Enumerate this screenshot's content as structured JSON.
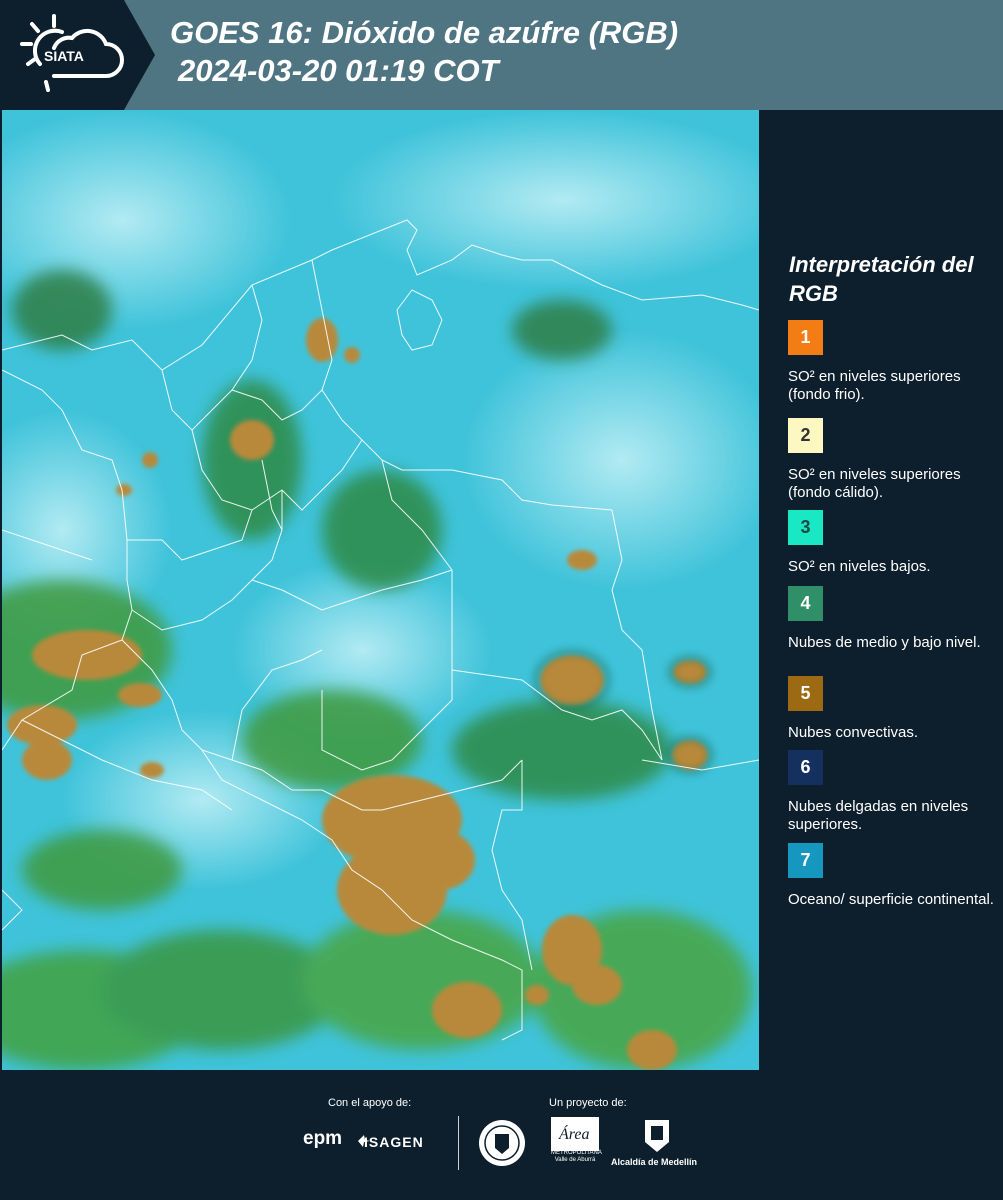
{
  "header": {
    "logo_text": "SIATA",
    "title_line1": "GOES 16: Dióxido de azúfre (RGB)",
    "title_line2": "2024-03-20 01:19 COT",
    "bg_color": "#4f7583"
  },
  "legend": {
    "title": "Interpretación del RGB",
    "items": [
      {
        "number": "1",
        "color": "#f47c14",
        "label": "SO² en niveles superiores (fondo frio)."
      },
      {
        "number": "2",
        "color": "#fdf7c2",
        "label": "SO² en niveles superiores (fondo cálido)."
      },
      {
        "number": "3",
        "color": "#1ae8c5",
        "label": "SO² en niveles bajos."
      },
      {
        "number": "4",
        "color": "#2e8f68",
        "label": "Nubes de medio y bajo nivel."
      },
      {
        "number": "5",
        "color": "#9c6a12",
        "label": "Nubes convectivas."
      },
      {
        "number": "6",
        "color": "#13305e",
        "label": "Nubes delgadas en niveles superiores."
      },
      {
        "number": "7",
        "color": "#1597bf",
        "label": "Oceano/ superficie continental."
      }
    ]
  },
  "footer": {
    "support_label": "Con el apoyo de:",
    "project_label": "Un proyecto de:",
    "sponsor1": "epm",
    "sponsor2": "ISAGEN",
    "partner1": "Universidad Nacional de Colombia - Medellín",
    "partner2_line1": "METROPOLITANA",
    "partner2_line2": "Valle de Aburrá",
    "partner3": "Alcaldía de Medellín"
  },
  "map": {
    "description_colors": {
      "ocean": "#3cc3dc",
      "clouds_convective": "#a98a45",
      "clouds_low": "#3f8f3a"
    }
  }
}
